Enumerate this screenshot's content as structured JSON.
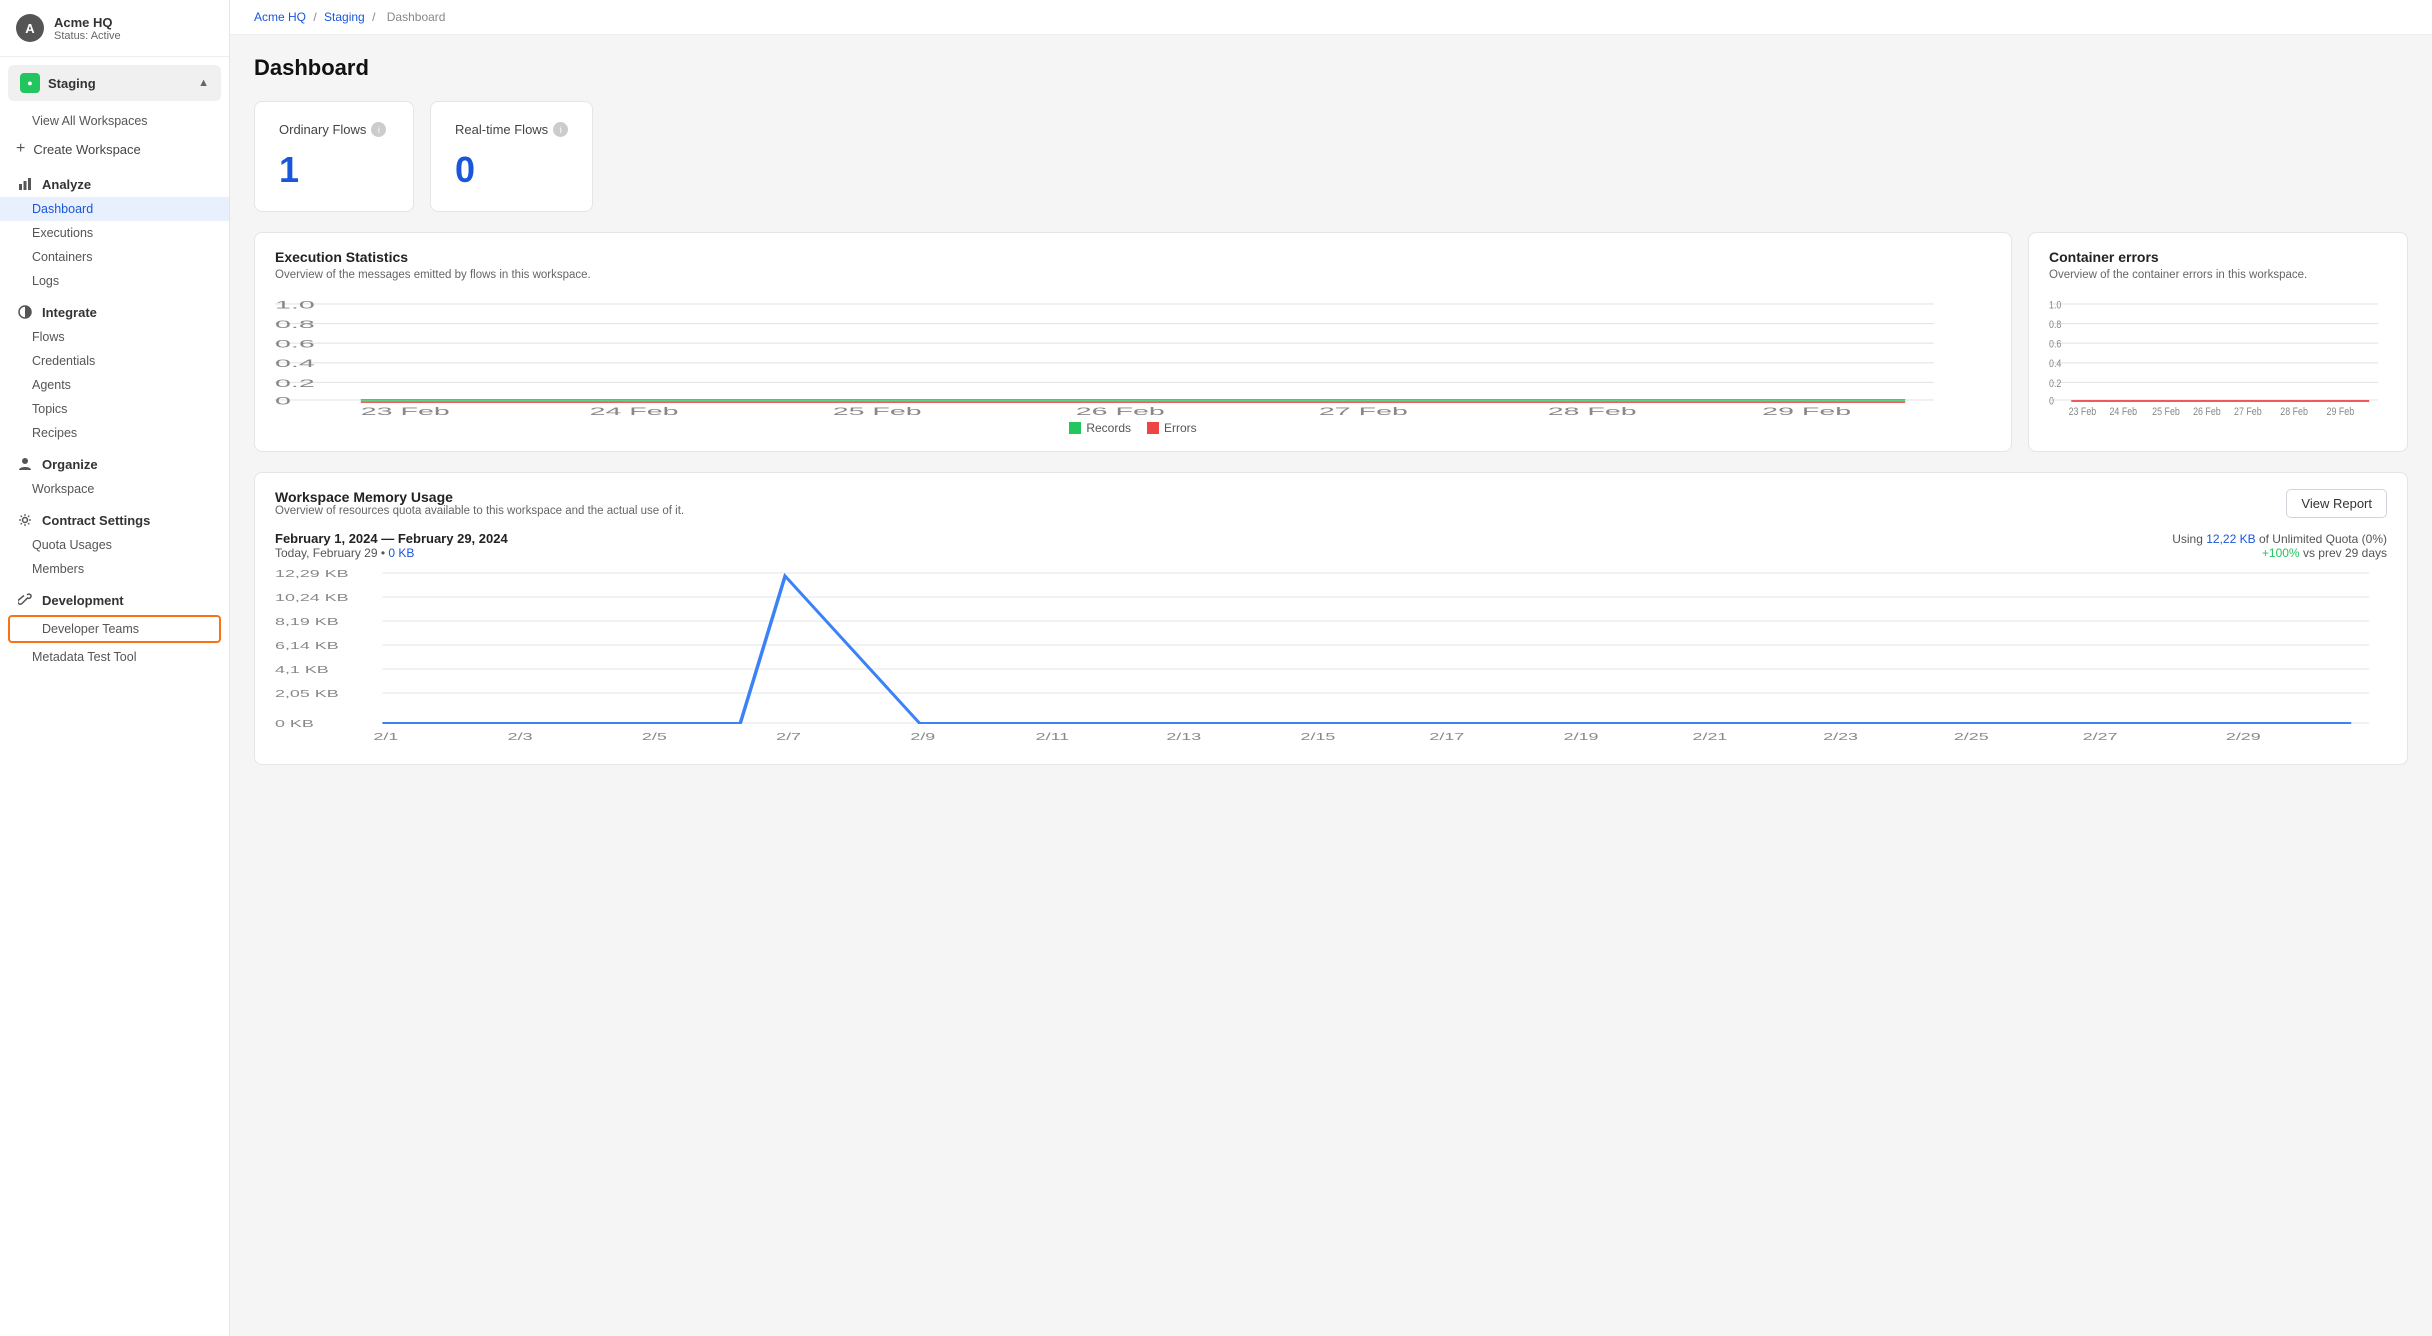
{
  "sidebar": {
    "avatar_letter": "A",
    "org_name": "Acme HQ",
    "org_status": "Status: Active",
    "workspace_name": "Staging",
    "view_all_workspaces": "View All Workspaces",
    "create_workspace": "Create Workspace",
    "sections": [
      {
        "id": "analyze",
        "label": "Analyze",
        "icon": "chart",
        "items": [
          "Dashboard",
          "Executions",
          "Containers",
          "Logs"
        ]
      },
      {
        "id": "integrate",
        "label": "Integrate",
        "icon": "circle-half",
        "items": [
          "Flows",
          "Credentials",
          "Agents",
          "Topics",
          "Recipes"
        ]
      },
      {
        "id": "organize",
        "label": "Organize",
        "icon": "person",
        "items": [
          "Workspace"
        ]
      },
      {
        "id": "contract",
        "label": "Contract Settings",
        "icon": "gear",
        "items": [
          "Quota Usages",
          "Members"
        ]
      },
      {
        "id": "development",
        "label": "Development",
        "icon": "wrench",
        "items": [
          "Developer Teams",
          "Metadata Test Tool"
        ]
      }
    ]
  },
  "breadcrumb": {
    "items": [
      "Acme HQ",
      "Staging",
      "Dashboard"
    ],
    "separator": "/"
  },
  "page": {
    "title": "Dashboard"
  },
  "stats": {
    "ordinary_flows": {
      "label": "Ordinary Flows",
      "value": "1"
    },
    "realtime_flows": {
      "label": "Real-time Flows",
      "value": "0"
    }
  },
  "execution_stats": {
    "title": "Execution Statistics",
    "subtitle": "Overview of the messages emitted by flows in this workspace.",
    "x_labels": [
      "23 Feb",
      "24 Feb",
      "25 Feb",
      "26 Feb",
      "27 Feb",
      "28 Feb",
      "29 Feb"
    ],
    "y_labels": [
      "0",
      "0.2",
      "0.4",
      "0.6",
      "0.8",
      "1.0"
    ],
    "legend": [
      {
        "label": "Records",
        "color": "#22c55e"
      },
      {
        "label": "Errors",
        "color": "#ef4444"
      }
    ]
  },
  "container_errors": {
    "title": "Container errors",
    "subtitle": "Overview of the container errors in this workspace.",
    "x_labels": [
      "23 Feb",
      "24 Feb",
      "25 Feb",
      "26 Feb",
      "27 Feb",
      "28 Feb",
      "29 Feb"
    ],
    "y_labels": [
      "0",
      "0.2",
      "0.4",
      "0.6",
      "0.8",
      "1.0"
    ]
  },
  "memory_usage": {
    "title": "Workspace Memory Usage",
    "subtitle": "Overview of resources quota available to this workspace and the actual use of it.",
    "date_range": "February 1, 2024 — February 29, 2024",
    "today_label": "Today, February 29",
    "today_value": "0 KB",
    "using_label": "Using",
    "using_value": "12,22 KB",
    "quota_label": "of Unlimited Quota (0%)",
    "increase_label": "+100%",
    "increase_suffix": "vs prev 29 days",
    "view_report_label": "View Report",
    "x_labels": [
      "2/1",
      "2/3",
      "2/5",
      "2/7",
      "2/9",
      "2/11",
      "2/13",
      "2/15",
      "2/17",
      "2/19",
      "2/21",
      "2/23",
      "2/25",
      "2/27",
      "2/29"
    ],
    "y_labels": [
      "0 KB",
      "2,05 KB",
      "4,1 KB",
      "6,14 KB",
      "8,19 KB",
      "10,24 KB",
      "12,29 KB"
    ]
  },
  "colors": {
    "primary": "#1a56db",
    "green": "#22c55e",
    "red": "#ef4444",
    "orange": "#f97316",
    "blue_chart": "#3b82f6"
  }
}
